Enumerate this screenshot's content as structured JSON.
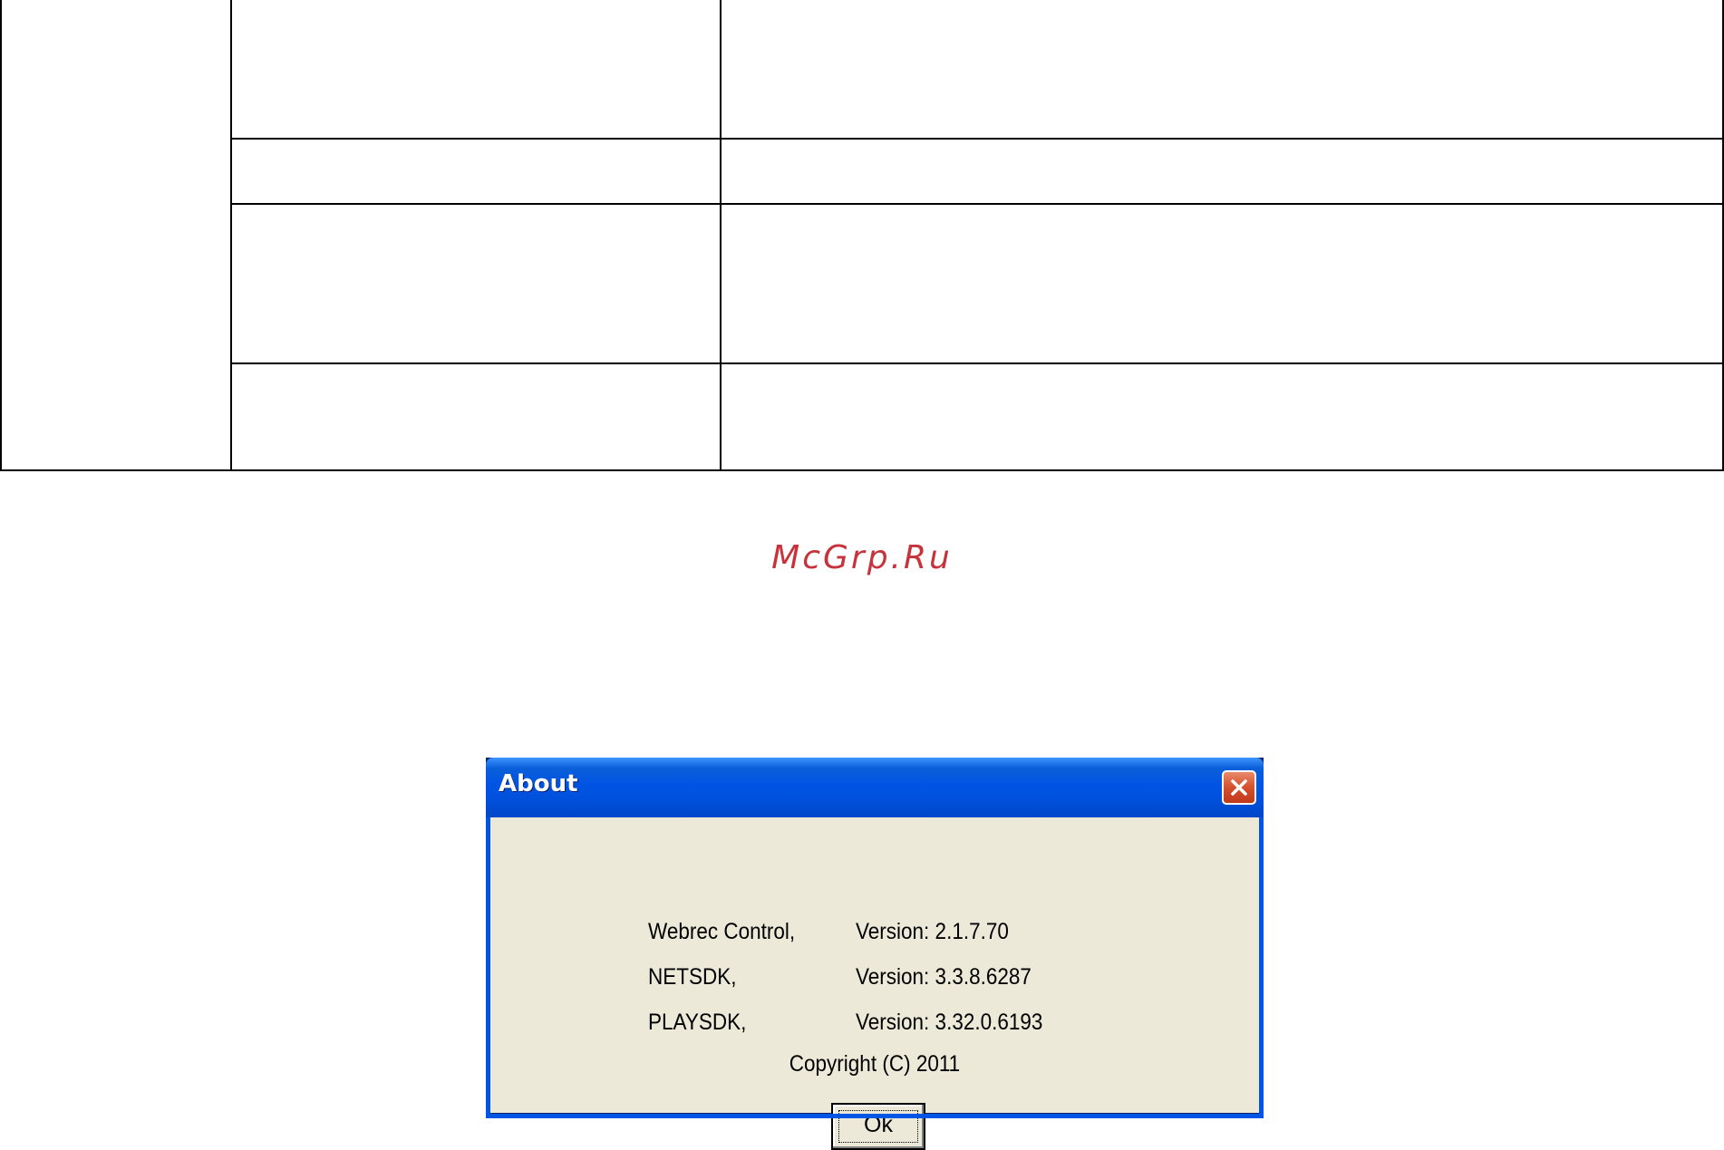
{
  "watermark": {
    "text": "McGrp.Ru"
  },
  "dialog": {
    "title": "About",
    "rows": [
      {
        "name": "Webrec Control,",
        "version": "Version: 2.1.7.70"
      },
      {
        "name": "NETSDK,",
        "version": "Version: 3.3.8.6287"
      },
      {
        "name": "PLAYSDK,",
        "version": "Version: 3.32.0.6193"
      }
    ],
    "copyright": "Copyright (C) 2011",
    "ok_label": "Ok"
  },
  "colors": {
    "titlebar": "#0054e3",
    "client": "#ece9d8",
    "close": "#d5502c",
    "watermark": "#c8323a"
  }
}
